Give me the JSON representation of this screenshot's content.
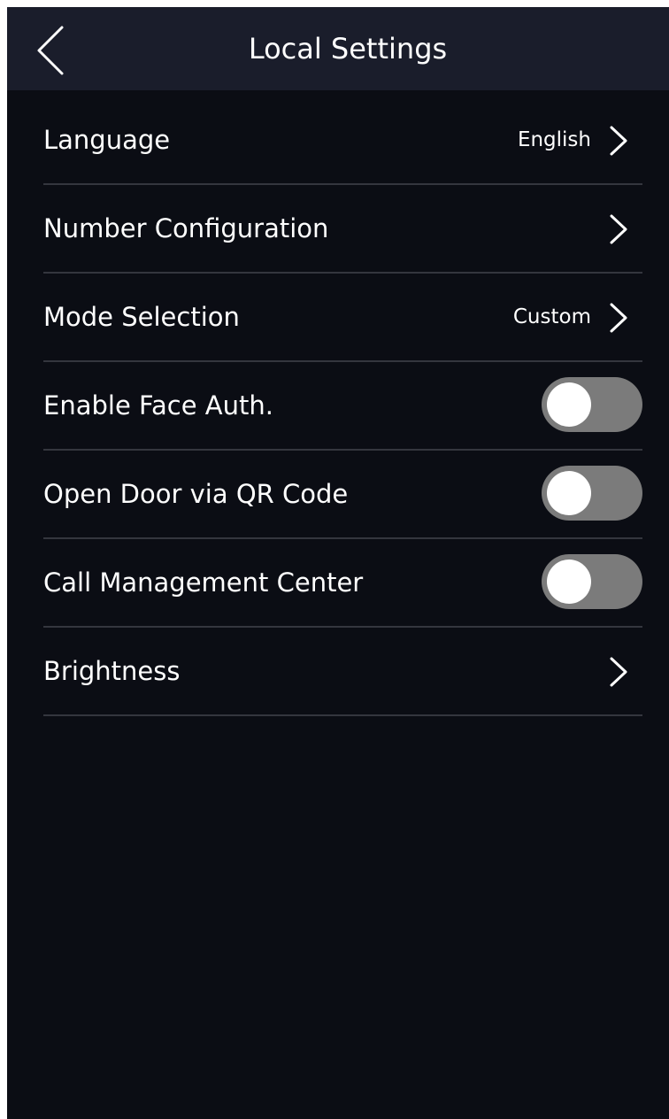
{
  "header": {
    "title": "Local Settings",
    "back_icon": "chevron-left-icon"
  },
  "settings": {
    "language": {
      "label": "Language",
      "value": "English",
      "icon": "chevron-right-icon"
    },
    "number_configuration": {
      "label": "Number Configuration",
      "icon": "chevron-right-icon"
    },
    "mode_selection": {
      "label": "Mode Selection",
      "value": "Custom",
      "icon": "chevron-right-icon"
    },
    "enable_face_auth": {
      "label": "Enable Face Auth.",
      "enabled": false
    },
    "open_door_qr": {
      "label": "Open Door via QR Code",
      "enabled": false
    },
    "call_management_center": {
      "label": "Call Management Center",
      "enabled": false
    },
    "brightness": {
      "label": "Brightness",
      "icon": "chevron-right-icon"
    }
  },
  "colors": {
    "background": "#0b0d14",
    "header": "#1a1d2b",
    "divider": "#34363e",
    "toggle_off": "#7b7b7b",
    "text": "#ffffff"
  }
}
